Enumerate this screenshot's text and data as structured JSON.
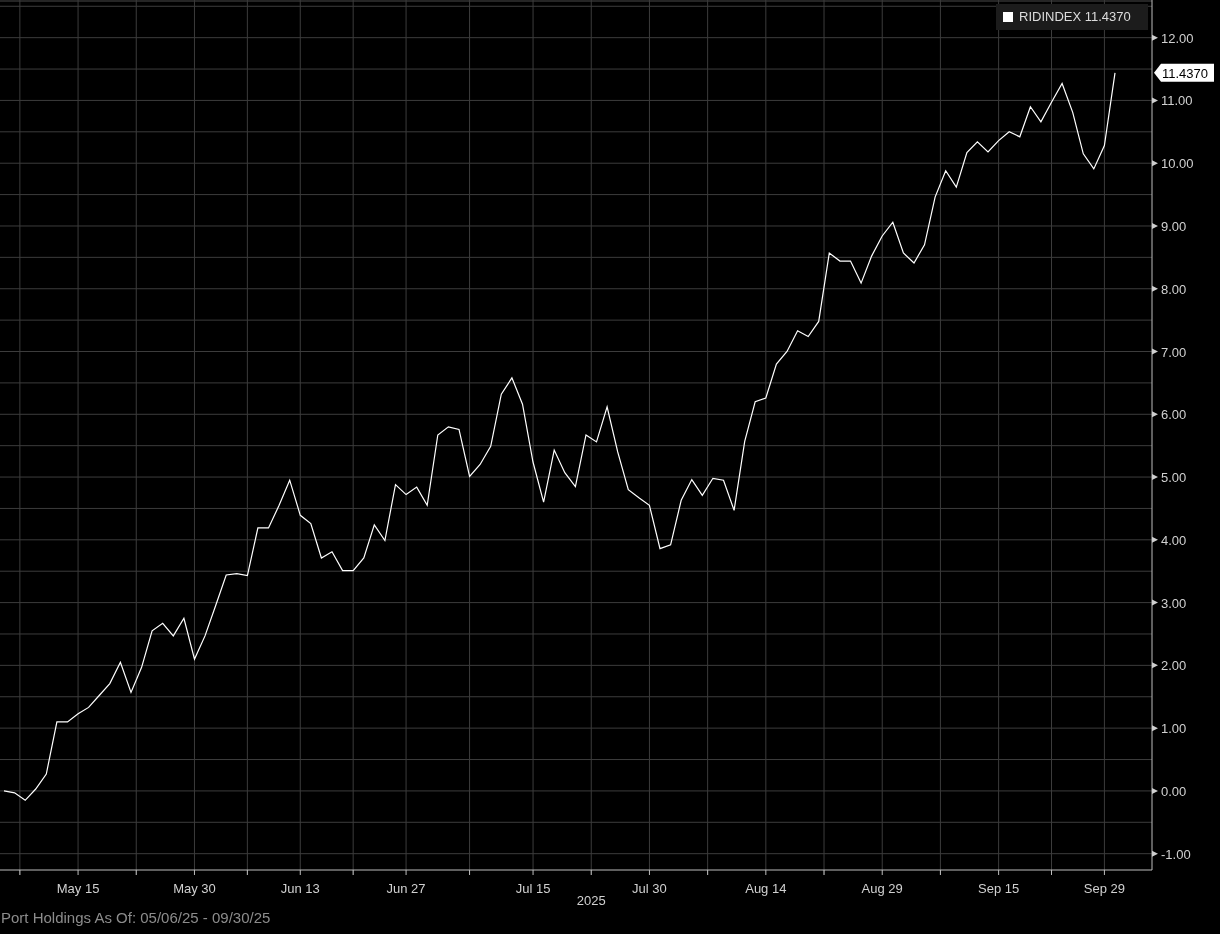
{
  "chart_data": {
    "type": "line",
    "xlabel": "2025",
    "grid": true,
    "categories": [
      null,
      null,
      null,
      null,
      null,
      null,
      null,
      "May 15",
      null,
      null,
      null,
      null,
      null,
      null,
      null,
      null,
      null,
      null,
      "May 30",
      null,
      null,
      null,
      null,
      null,
      null,
      null,
      null,
      null,
      "Jun 13",
      null,
      null,
      null,
      null,
      null,
      null,
      null,
      null,
      null,
      "Jun 27",
      null,
      null,
      null,
      null,
      null,
      null,
      null,
      null,
      null,
      null,
      null,
      "Jul 15",
      null,
      null,
      null,
      null,
      null,
      null,
      null,
      null,
      null,
      null,
      "Jul 30",
      null,
      null,
      null,
      null,
      null,
      null,
      null,
      null,
      null,
      null,
      "Aug 14",
      null,
      null,
      null,
      null,
      null,
      null,
      null,
      null,
      null,
      null,
      "Aug 29",
      null,
      null,
      null,
      null,
      null,
      null,
      null,
      null,
      null,
      null,
      "Sep 15",
      null,
      null,
      null,
      null,
      null,
      null,
      null,
      null,
      null,
      "Sep 29",
      null
    ],
    "series": [
      {
        "name": "RIDINDEX",
        "color": "#ffffff",
        "values": [
          0.0,
          -0.03,
          -0.15,
          0.03,
          0.27,
          1.1,
          1.1,
          1.23,
          1.33,
          1.52,
          1.71,
          2.05,
          1.57,
          1.97,
          2.55,
          2.67,
          2.47,
          2.75,
          2.1,
          2.47,
          2.95,
          3.44,
          3.46,
          3.43,
          4.19,
          4.19,
          4.55,
          4.95,
          4.39,
          4.26,
          3.71,
          3.81,
          3.51,
          3.51,
          3.71,
          4.24,
          3.99,
          4.88,
          4.72,
          4.84,
          4.55,
          5.67,
          5.8,
          5.76,
          5.01,
          5.2,
          5.49,
          6.32,
          6.58,
          6.16,
          5.24,
          4.6,
          5.43,
          5.07,
          4.85,
          5.67,
          5.56,
          6.12,
          5.4,
          4.8,
          4.67,
          4.55,
          3.86,
          3.92,
          4.63,
          4.96,
          4.71,
          4.98,
          4.95,
          4.47,
          5.57,
          6.2,
          6.26,
          6.8,
          7.0,
          7.33,
          7.24,
          7.48,
          8.57,
          8.44,
          8.44,
          8.09,
          8.52,
          8.84,
          9.06,
          8.57,
          8.41,
          8.7,
          9.46,
          9.88,
          9.62,
          10.17,
          10.34,
          10.18,
          10.36,
          10.5,
          10.42,
          10.9,
          10.66,
          10.97,
          11.27,
          10.81,
          10.15,
          9.91,
          10.28,
          11.44
        ]
      }
    ],
    "ylim": [
      -1.26,
      12.6
    ],
    "yticks": [
      {
        "value": 12,
        "label": "12.00"
      },
      {
        "value": 11,
        "label": "11.00"
      },
      {
        "value": 10,
        "label": "10.00"
      },
      {
        "value": 9,
        "label": "9.00"
      },
      {
        "value": 8,
        "label": "8.00"
      },
      {
        "value": 7,
        "label": "7.00"
      },
      {
        "value": 6,
        "label": "6.00"
      },
      {
        "value": 5,
        "label": "5.00"
      },
      {
        "value": 4,
        "label": "4.00"
      },
      {
        "value": 3,
        "label": "3.00"
      },
      {
        "value": 2,
        "label": "2.00"
      },
      {
        "value": 1,
        "label": "1.00"
      },
      {
        "value": 0,
        "label": "0.00"
      },
      {
        "value": -1,
        "label": "-1.00"
      }
    ]
  },
  "legend": {
    "value": "11.4370"
  },
  "last_value_tag": "11.4370",
  "footer": "Port Holdings As Of: 05/06/25 - 09/30/25"
}
